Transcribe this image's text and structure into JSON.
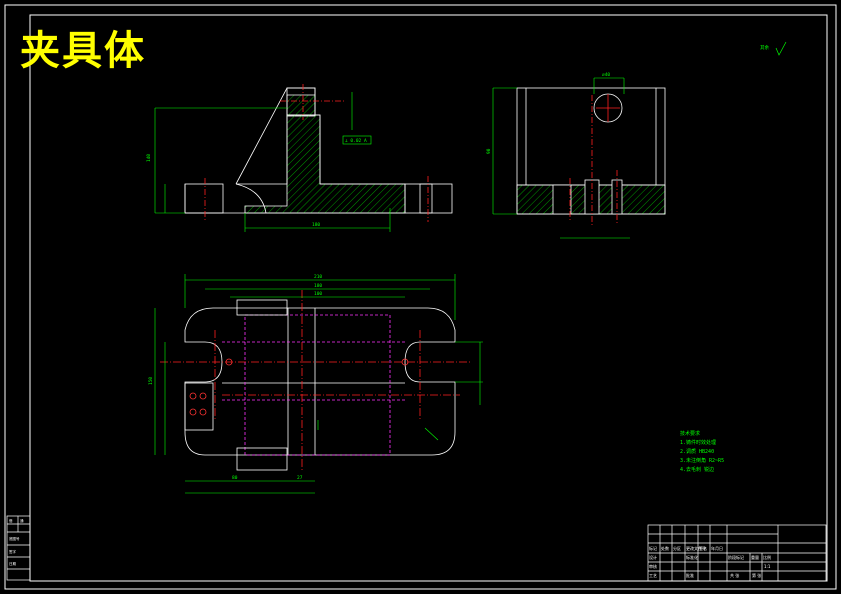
{
  "title": "夹具体",
  "roughness_note": "其余",
  "technical_requirements": {
    "heading": "技术要求",
    "items": [
      "1.铸件时效处理",
      "2.调质 HB240",
      "3.未注倒角 R2~R5",
      "4.去毛刺 锐边"
    ]
  },
  "dimensions": {
    "front_overall_height": "140",
    "front_base_length": "180",
    "top_overall_width": "210",
    "top_inner_width": "180",
    "top_slot_width": "100",
    "top_depth": "150",
    "top_left_offset": "80",
    "top_right_offset": "27",
    "side_bore": "⌀40",
    "side_height": "90",
    "tolerance_frame": "⊥ 0.02 A"
  },
  "title_block": {
    "row1": [
      "标记",
      "处数",
      "分区",
      "更改文件号",
      "签名",
      "年月日"
    ],
    "row2": [
      "设计",
      "",
      "标准化",
      "",
      "阶段标记",
      "重量",
      "比例"
    ],
    "row3": [
      "审核",
      "",
      "",
      "",
      "",
      "",
      "1:1"
    ],
    "row4": [
      "工艺",
      "",
      "批准",
      "",
      "共 张",
      "第 张"
    ]
  },
  "side_stamp": [
    "借",
    "通",
    "底图号",
    "签字",
    "日期"
  ]
}
